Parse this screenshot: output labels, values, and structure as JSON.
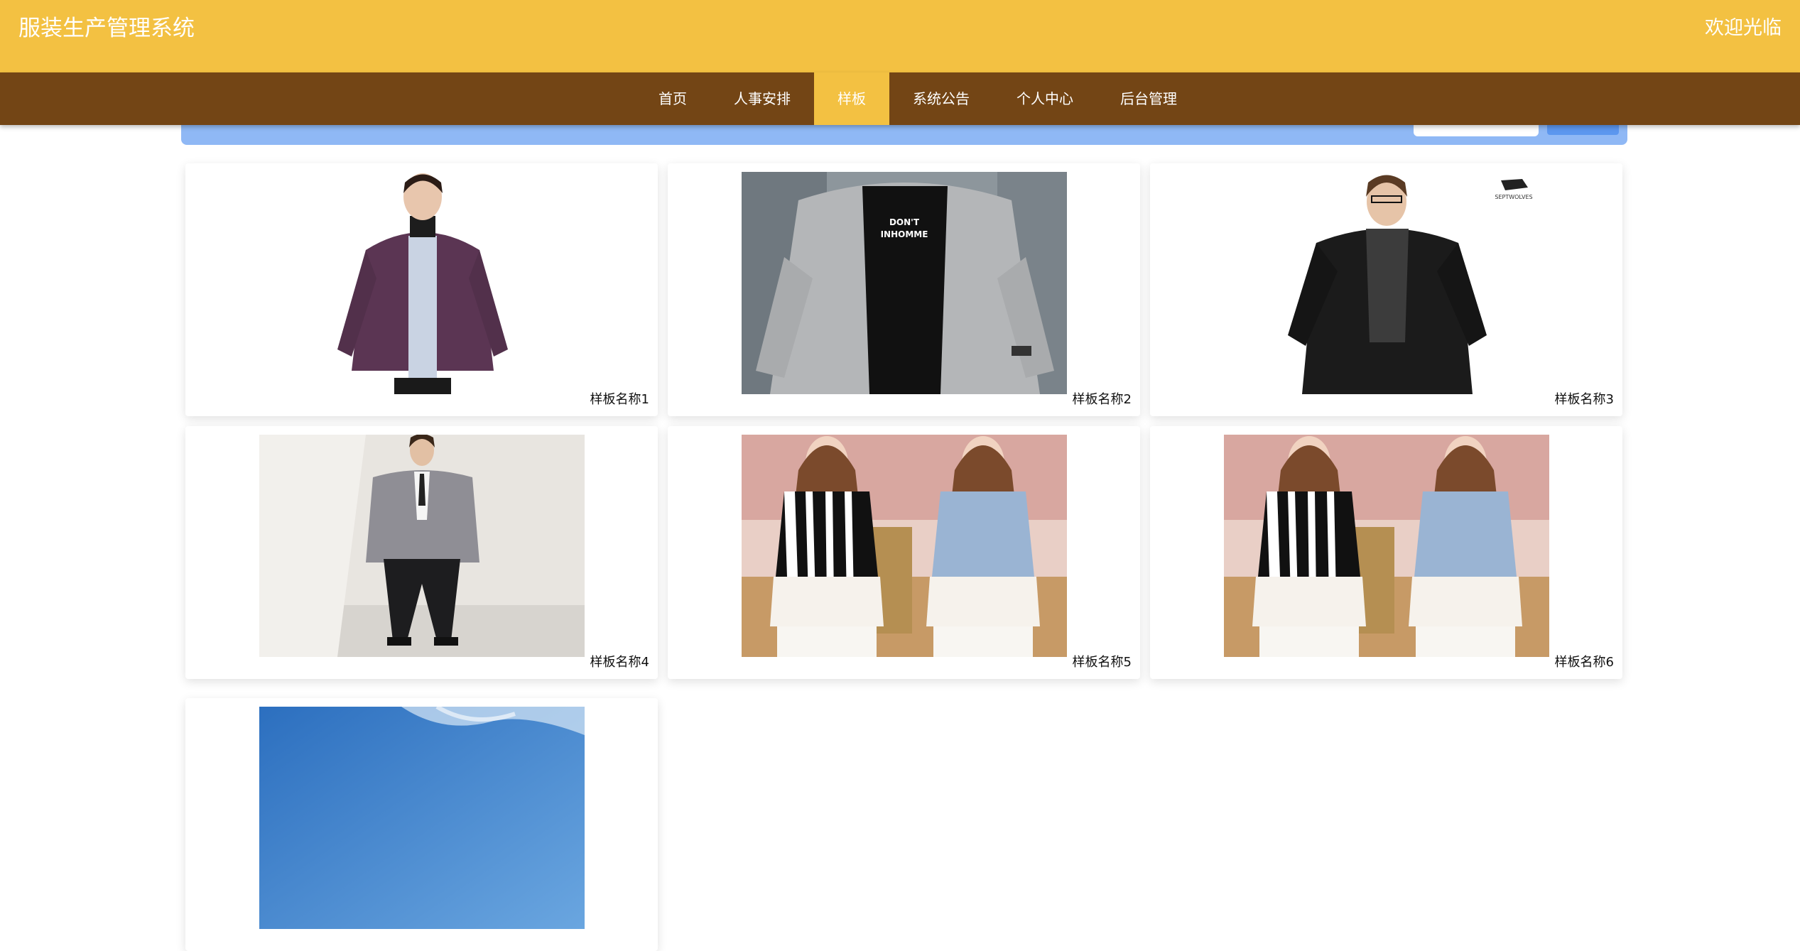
{
  "header": {
    "title": "服装生产管理系统",
    "welcome": "欢迎光临"
  },
  "nav": {
    "items": [
      "首页",
      "人事安排",
      "样板",
      "系统公告",
      "个人中心",
      "后台管理"
    ],
    "active_index": 2
  },
  "colors": {
    "header": "#f3c142",
    "navbar": "#734515",
    "active_tab": "#f3c142",
    "search_bar": "#8fb8f5",
    "search_button": "#5c97ef"
  },
  "samples": [
    {
      "name": "样板名称1",
      "image": "man-purple-fleece-jacket"
    },
    {
      "name": "样板名称2",
      "image": "man-gray-hooded-jacket"
    },
    {
      "name": "样板名称3",
      "image": "man-black-jacket-scarf"
    },
    {
      "name": "样板名称4",
      "image": "man-gray-blazer"
    },
    {
      "name": "样板名称5",
      "image": "women-lace-tops"
    },
    {
      "name": "样板名称6",
      "image": "women-lace-tops"
    },
    {
      "name": "",
      "image": "blue-sky"
    }
  ],
  "images": {
    "sept_logo": "SEPTWOLVES",
    "tshirt_text_1": "DON'T",
    "tshirt_text_2": "INHOMME"
  }
}
